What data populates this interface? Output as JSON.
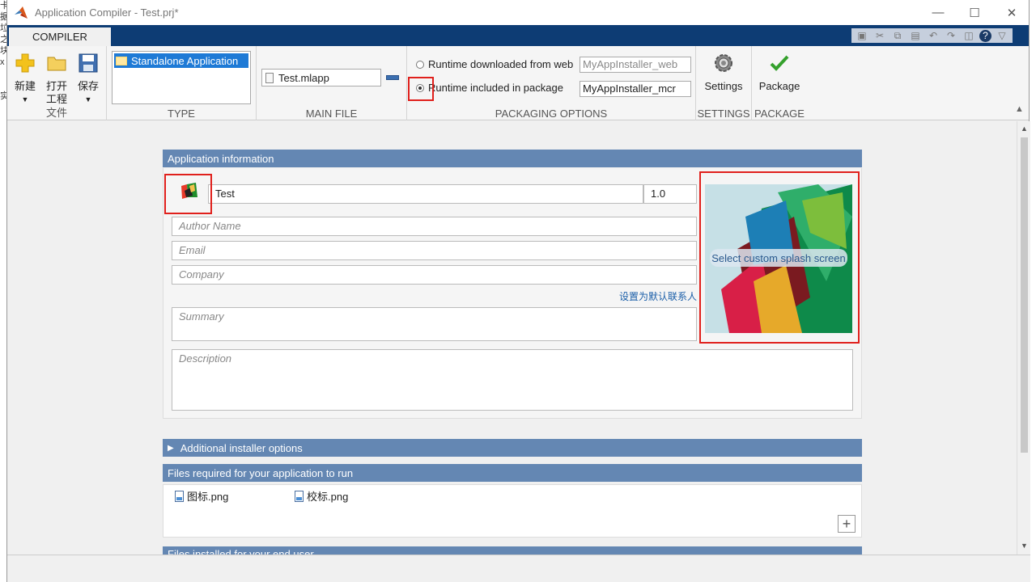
{
  "window": {
    "title": "Application Compiler - Test.prj*"
  },
  "tabs": {
    "compiler": "COMPILER"
  },
  "file_group": {
    "new": "新建",
    "open_l1": "打开",
    "open_l2": "工程",
    "save": "保存",
    "label": "文件"
  },
  "type_group": {
    "selected": "Standalone Application",
    "label": "TYPE"
  },
  "main_file_group": {
    "file": "Test.mlapp",
    "label": "MAIN FILE"
  },
  "packaging": {
    "option_web": "Runtime downloaded from web",
    "web_value": "MyAppInstaller_web",
    "option_included": "Runtime included in package",
    "included_value": "MyAppInstaller_mcr",
    "label": "PACKAGING OPTIONS"
  },
  "settings_group": {
    "button": "Settings",
    "label": "SETTINGS"
  },
  "package_group": {
    "button": "Package",
    "label": "PACKAGE"
  },
  "app_info": {
    "header": "Application information",
    "name": "Test",
    "version": "1.0",
    "author_placeholder": "Author Name",
    "email_placeholder": "Email",
    "company_placeholder": "Company",
    "default_contact_link": "设置为默认联系人",
    "summary_placeholder": "Summary",
    "description_placeholder": "Description",
    "splash_button": "Select custom splash screen"
  },
  "sections": {
    "additional": "Additional installer options",
    "files_required": "Files required for your application to run",
    "files_installed": "Files installed for your end user"
  },
  "files": [
    "图标.png",
    "校标.png"
  ],
  "colors": {
    "accent": "#0d3c74",
    "section_header": "#6487b3",
    "highlight": "#e0201c",
    "selection": "#1e7ad6"
  }
}
